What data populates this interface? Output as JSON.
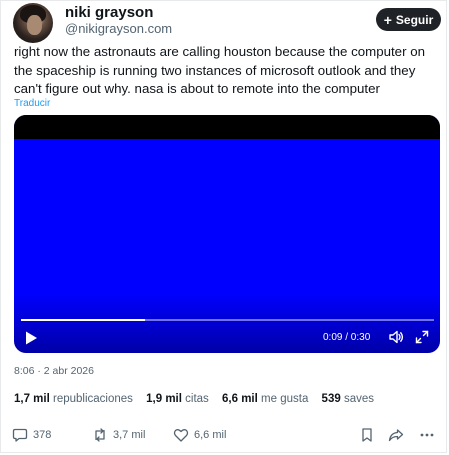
{
  "user": {
    "name": "niki grayson",
    "handle": "@nikigrayson.com"
  },
  "follow": {
    "icon": "plus-icon",
    "label": "Seguir"
  },
  "tweet": {
    "text": "right now the astronauts are calling houston because the computer on the spaceship is running two instances of microsoft outlook and they can't figure out why. nasa is about to remote into the computer",
    "translate_label": "Traducir"
  },
  "video": {
    "background_color": "#0000ff",
    "time_label": "0:09 / 0:30",
    "progress_fraction": 0.3,
    "controls": [
      "play-icon",
      "volume-icon",
      "fullscreen-icon"
    ]
  },
  "meta": {
    "timestamp": "8:06 · 2 abr 2026"
  },
  "stats": [
    {
      "value": "1,7 mil",
      "label": "republicaciones"
    },
    {
      "value": "1,9 mil",
      "label": "citas"
    },
    {
      "value": "6,6 mil",
      "label": "me gusta"
    },
    {
      "value": "539",
      "label": "saves"
    }
  ],
  "actions": {
    "reply": {
      "icon": "reply-icon",
      "count": "378"
    },
    "repost": {
      "icon": "repost-icon",
      "count": "3,7 mil"
    },
    "like": {
      "icon": "heart-icon",
      "count": "6,6 mil"
    },
    "bookmark": {
      "icon": "bookmark-icon"
    },
    "share": {
      "icon": "share-icon"
    },
    "more": {
      "icon": "more-icon"
    }
  }
}
